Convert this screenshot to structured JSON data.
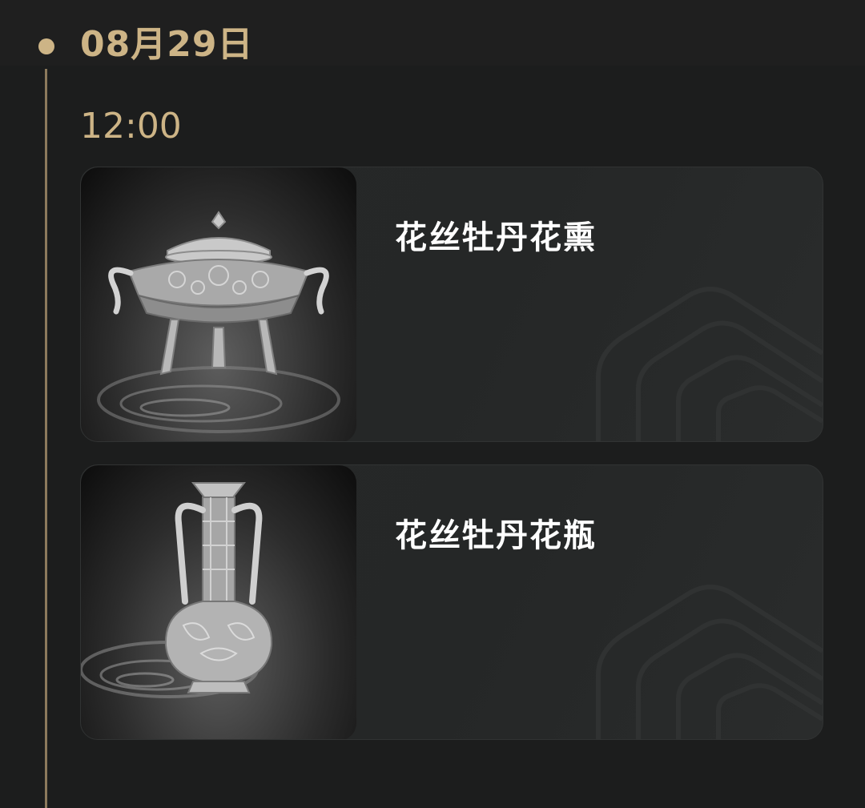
{
  "timeline": {
    "date": "08月29日",
    "time": "12:00"
  },
  "items": [
    {
      "title": "花丝牡丹花熏",
      "image_icon": "censer-icon"
    },
    {
      "title": "花丝牡丹花瓶",
      "image_icon": "vase-icon"
    }
  ],
  "colors": {
    "accent_gold": "#cdb486",
    "background": "#1c1d1d",
    "card_bg": "#262828",
    "title_text": "#ffffff"
  }
}
